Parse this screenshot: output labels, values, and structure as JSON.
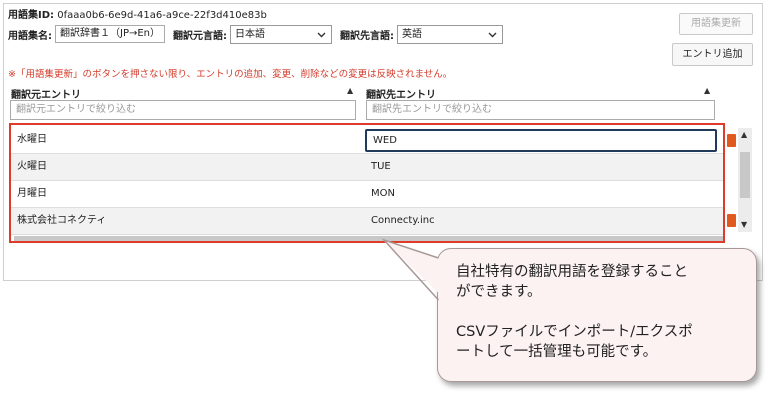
{
  "header": {
    "id_label": "用語集ID:",
    "id_value": "0faaa0b6-6e9d-41a6-a9ce-22f3d410e83b",
    "name_label": "用語集名:",
    "name_value": "翻訳辞書１（JP→En）",
    "source_lang_label": "翻訳元言語:",
    "source_lang_value": "日本語",
    "target_lang_label": "翻訳先言語:",
    "target_lang_value": "英語"
  },
  "buttons": {
    "update": "用語集更新",
    "add_entry": "エントリ追加"
  },
  "warning": "※「用語集更新」のボタンを押さない限り、エントリの追加、変更、削除などの変更は反映されません。",
  "columns": {
    "source": "翻訳元エントリ",
    "target": "翻訳先エントリ",
    "source_filter_placeholder": "翻訳元エントリで絞り込む",
    "target_filter_placeholder": "翻訳先エントリで絞り込む"
  },
  "entries": [
    {
      "source": "水曜日",
      "target": "WED"
    },
    {
      "source": "火曜日",
      "target": "TUE"
    },
    {
      "source": "月曜日",
      "target": "MON"
    },
    {
      "source": "株式会社コネクティ",
      "target": "Connecty.inc"
    }
  ],
  "callout": {
    "text": "自社特有の翻訳用語を登録すること\nができます。\n\nCSVファイルでインポート/エクスポ\nートして一括管理も可能です。"
  },
  "colors": {
    "highlight": "#e03a2a",
    "warning": "#d23c2a",
    "callout_bg": "#fbf2f1",
    "delete_icon": "#e05a20"
  }
}
